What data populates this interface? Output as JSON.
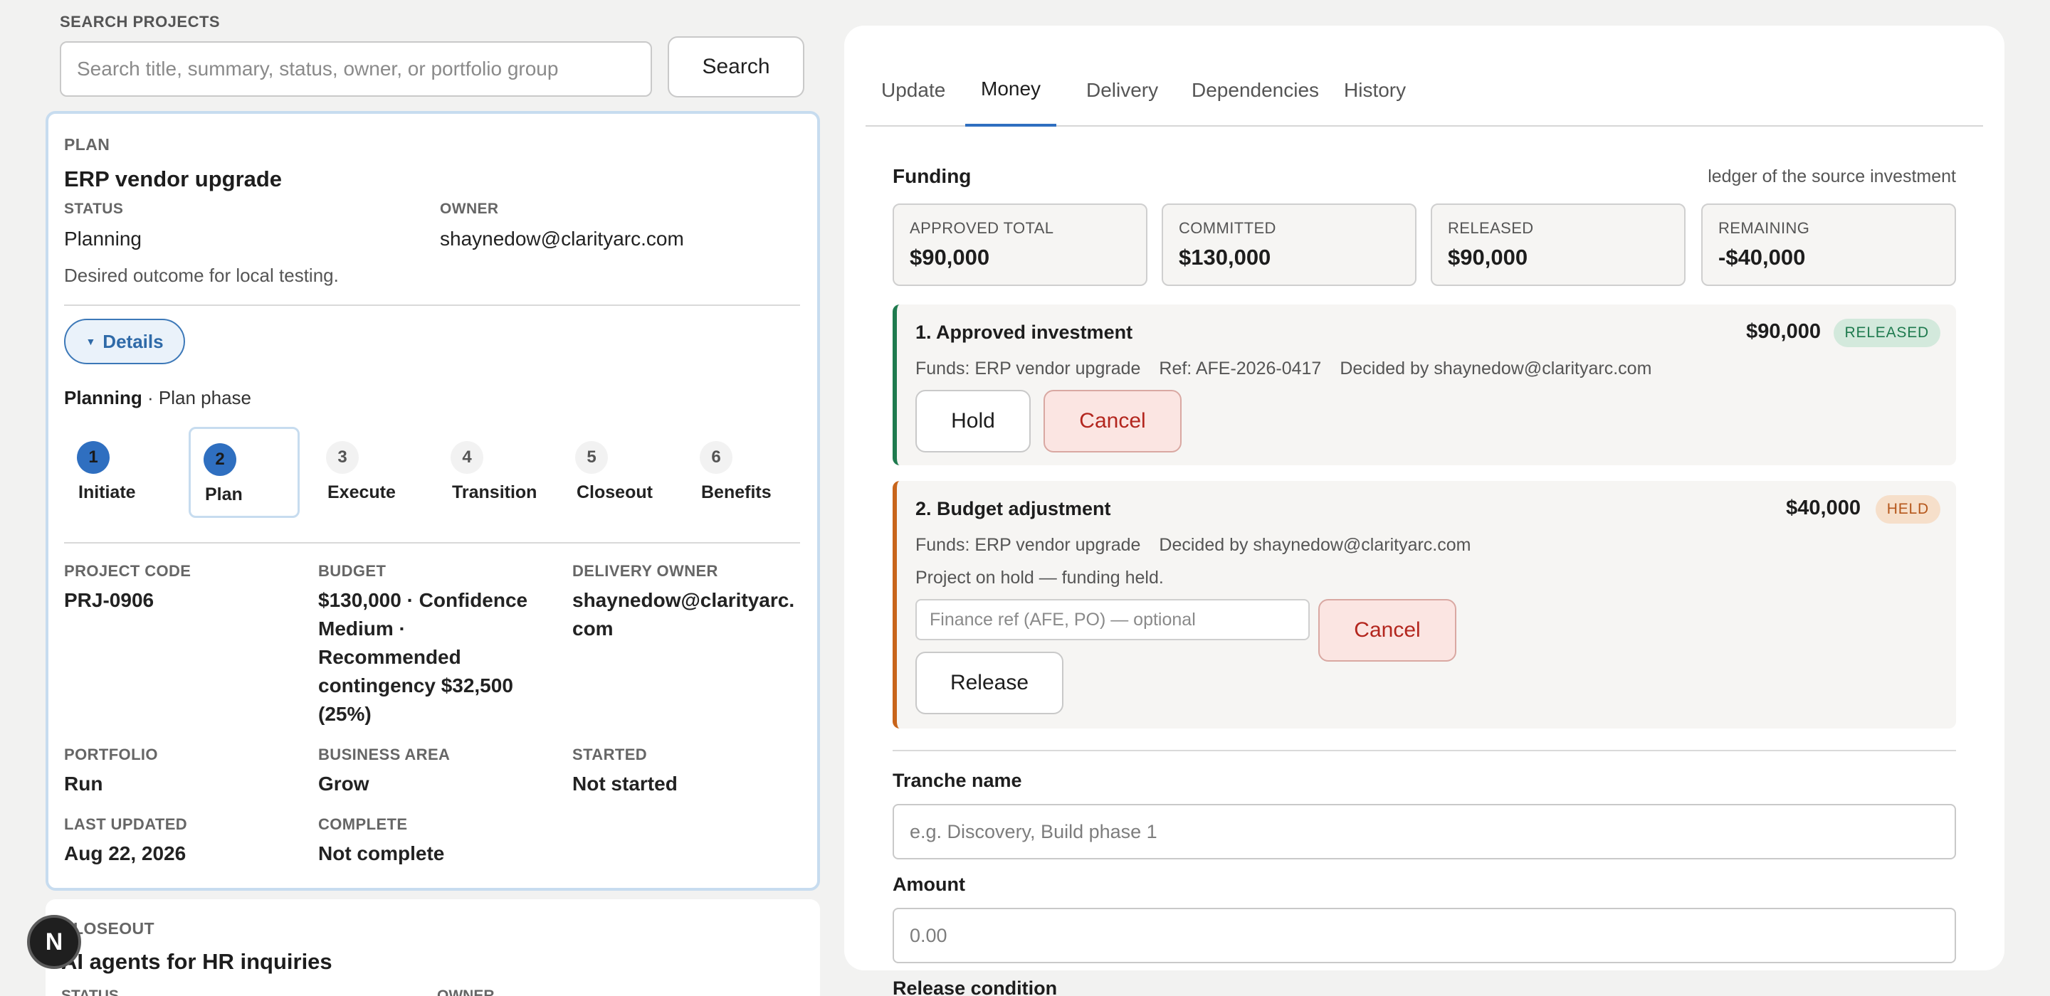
{
  "search": {
    "label": "SEARCH PROJECTS",
    "placeholder": "Search title, summary, status, owner, or portfolio group",
    "button": "Search"
  },
  "project": {
    "phase": "PLAN",
    "title": "ERP vendor upgrade",
    "status_label": "STATUS",
    "status": "Planning",
    "owner_label": "OWNER",
    "owner": "shaynedow@clarityarc.com",
    "description": "Desired outcome for local testing.",
    "details_button": "Details",
    "phase_line_status": "Planning",
    "phase_line_rest": " · Plan phase",
    "steps": [
      {
        "num": "1",
        "label": "Initiate",
        "state": "done"
      },
      {
        "num": "2",
        "label": "Plan",
        "state": "done"
      },
      {
        "num": "3",
        "label": "Execute",
        "state": "todo"
      },
      {
        "num": "4",
        "label": "Transition",
        "state": "todo"
      },
      {
        "num": "5",
        "label": "Closeout",
        "state": "todo"
      },
      {
        "num": "6",
        "label": "Benefits",
        "state": "todo"
      }
    ],
    "active_step": "2",
    "meta": {
      "project_code_label": "PROJECT CODE",
      "project_code": "PRJ-0906",
      "budget_label": "BUDGET",
      "budget_lines": [
        "$130,000 · Confidence",
        "Medium ·",
        "Recommended",
        "contingency $32,500",
        "(25%)"
      ],
      "delivery_owner_label": "DELIVERY OWNER",
      "delivery_owner_lines": [
        "shaynedow@clarityarc.",
        "com"
      ],
      "portfolio_label": "PORTFOLIO",
      "portfolio": "Run",
      "business_area_label": "BUSINESS AREA",
      "business_area": "Grow",
      "started_label": "STARTED",
      "started": "Not started",
      "last_updated_label": "LAST UPDATED",
      "last_updated": "Aug 22, 2026",
      "complete_label": "COMPLETE",
      "complete": "Not complete"
    }
  },
  "second_project": {
    "phase": "CLOSEOUT",
    "title": "AI agents for HR inquiries",
    "status_label": "STATUS",
    "owner_label": "OWNER"
  },
  "avatar": {
    "initial": "N"
  },
  "tabs": [
    "Update",
    "Money",
    "Delivery",
    "Dependencies",
    "History"
  ],
  "active_tab": "Money",
  "funding": {
    "title": "Funding",
    "note": "ledger of the source investment",
    "stats": [
      {
        "label": "APPROVED TOTAL",
        "value": "$90,000"
      },
      {
        "label": "COMMITTED",
        "value": "$130,000"
      },
      {
        "label": "RELEASED",
        "value": "$90,000"
      },
      {
        "label": "REMAINING",
        "value": "-$40,000"
      }
    ],
    "colors": {
      "released": "#1e7a4e",
      "held": "#c8641a",
      "accent": "#2f6fc0",
      "cancel": "#b3261e"
    },
    "tranches": [
      {
        "title": "1. Approved investment",
        "amount": "$90,000",
        "badge": "RELEASED",
        "funds": "Funds: ERP vendor upgrade",
        "ref": "Ref: AFE-2026-0417",
        "decided": "Decided by shaynedow@clarityarc.com",
        "hold_button": "Hold",
        "cancel_button": "Cancel"
      },
      {
        "title": "2. Budget adjustment",
        "amount": "$40,000",
        "badge": "HELD",
        "funds": "Funds: ERP vendor upgrade",
        "decided": "Decided by shaynedow@clarityarc.com",
        "note": "Project on hold — funding held.",
        "finref_placeholder": "Finance ref (AFE, PO) — optional",
        "cancel_button": "Cancel",
        "release_button": "Release"
      }
    ]
  },
  "form": {
    "tranche_name_label": "Tranche name",
    "tranche_name_placeholder": "e.g. Discovery, Build phase 1",
    "amount_label": "Amount",
    "amount_placeholder": "0.00",
    "release_condition_label": "Release condition"
  }
}
